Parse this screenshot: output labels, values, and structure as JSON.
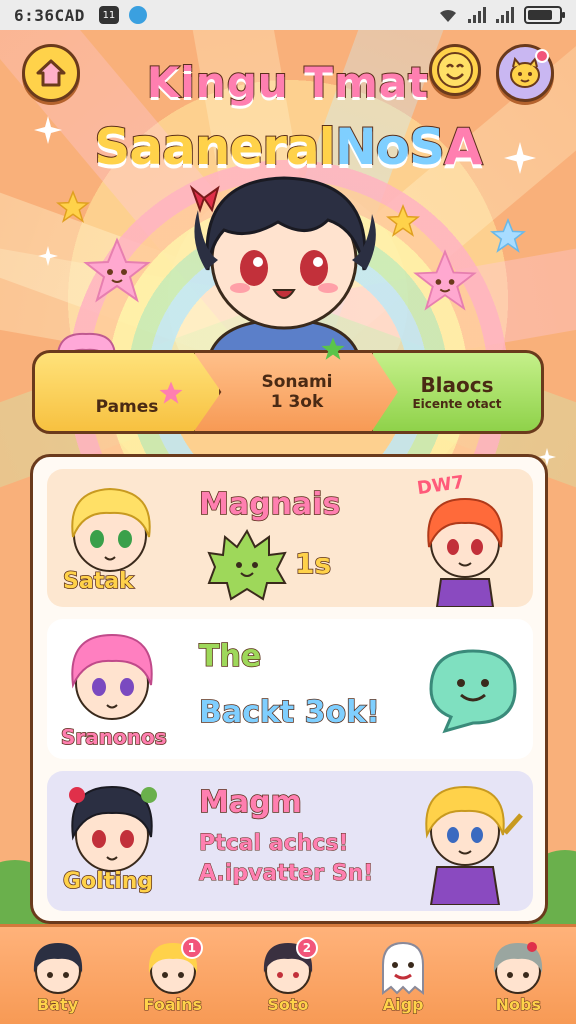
{
  "status_bar": {
    "time": "6:36CAD",
    "badge": "11",
    "icons": [
      "wifi-icon",
      "signal-icon",
      "signal-icon",
      "battery-icon"
    ]
  },
  "header": {
    "title_line1": "Kingu Tmat",
    "title_line2_a": "Saaneral",
    "title_line2_b": "NoS",
    "title_line2_c": "A",
    "left_button_icon": "home-icon",
    "right_button_icons": [
      "smile-icon",
      "friend-icon"
    ]
  },
  "stages": [
    {
      "label": "Pames",
      "sub": ""
    },
    {
      "label": "Sonami",
      "sub": "1 3ok"
    },
    {
      "label": "Blaocs",
      "sub": "Eicente otact"
    }
  ],
  "cards": [
    {
      "name": "Satak",
      "title": "Magnais",
      "count": "1s",
      "tag": "DW7",
      "title_color": "#ff7fb0"
    },
    {
      "name": "Sranonos",
      "title_line1": "The",
      "title_line2": "Backt 3ok!"
    },
    {
      "name": "Golting",
      "title": "Magm",
      "line1": "Ptcal achcs!",
      "line2": "A.ipvatter Sn!"
    }
  ],
  "bottom_nav": [
    {
      "label": "Baty",
      "icon": "avatar-dark-icon",
      "badge": ""
    },
    {
      "label": "Foains",
      "icon": "avatar-blonde-icon",
      "badge": "1"
    },
    {
      "label": "Soto",
      "icon": "avatar-dark2-icon",
      "badge": "2"
    },
    {
      "label": "Aigp",
      "icon": "ghost-icon",
      "badge": ""
    },
    {
      "label": "Nobs",
      "icon": "avatar-grey-icon",
      "badge": ""
    }
  ],
  "colors": {
    "accent_yellow": "#ffd24a",
    "accent_pink": "#ff7fb0",
    "accent_green": "#8fd24a",
    "accent_blue": "#7fcfff",
    "outline_brown": "#6a3a1c",
    "bottom_nav_orange": "#f79a55"
  }
}
